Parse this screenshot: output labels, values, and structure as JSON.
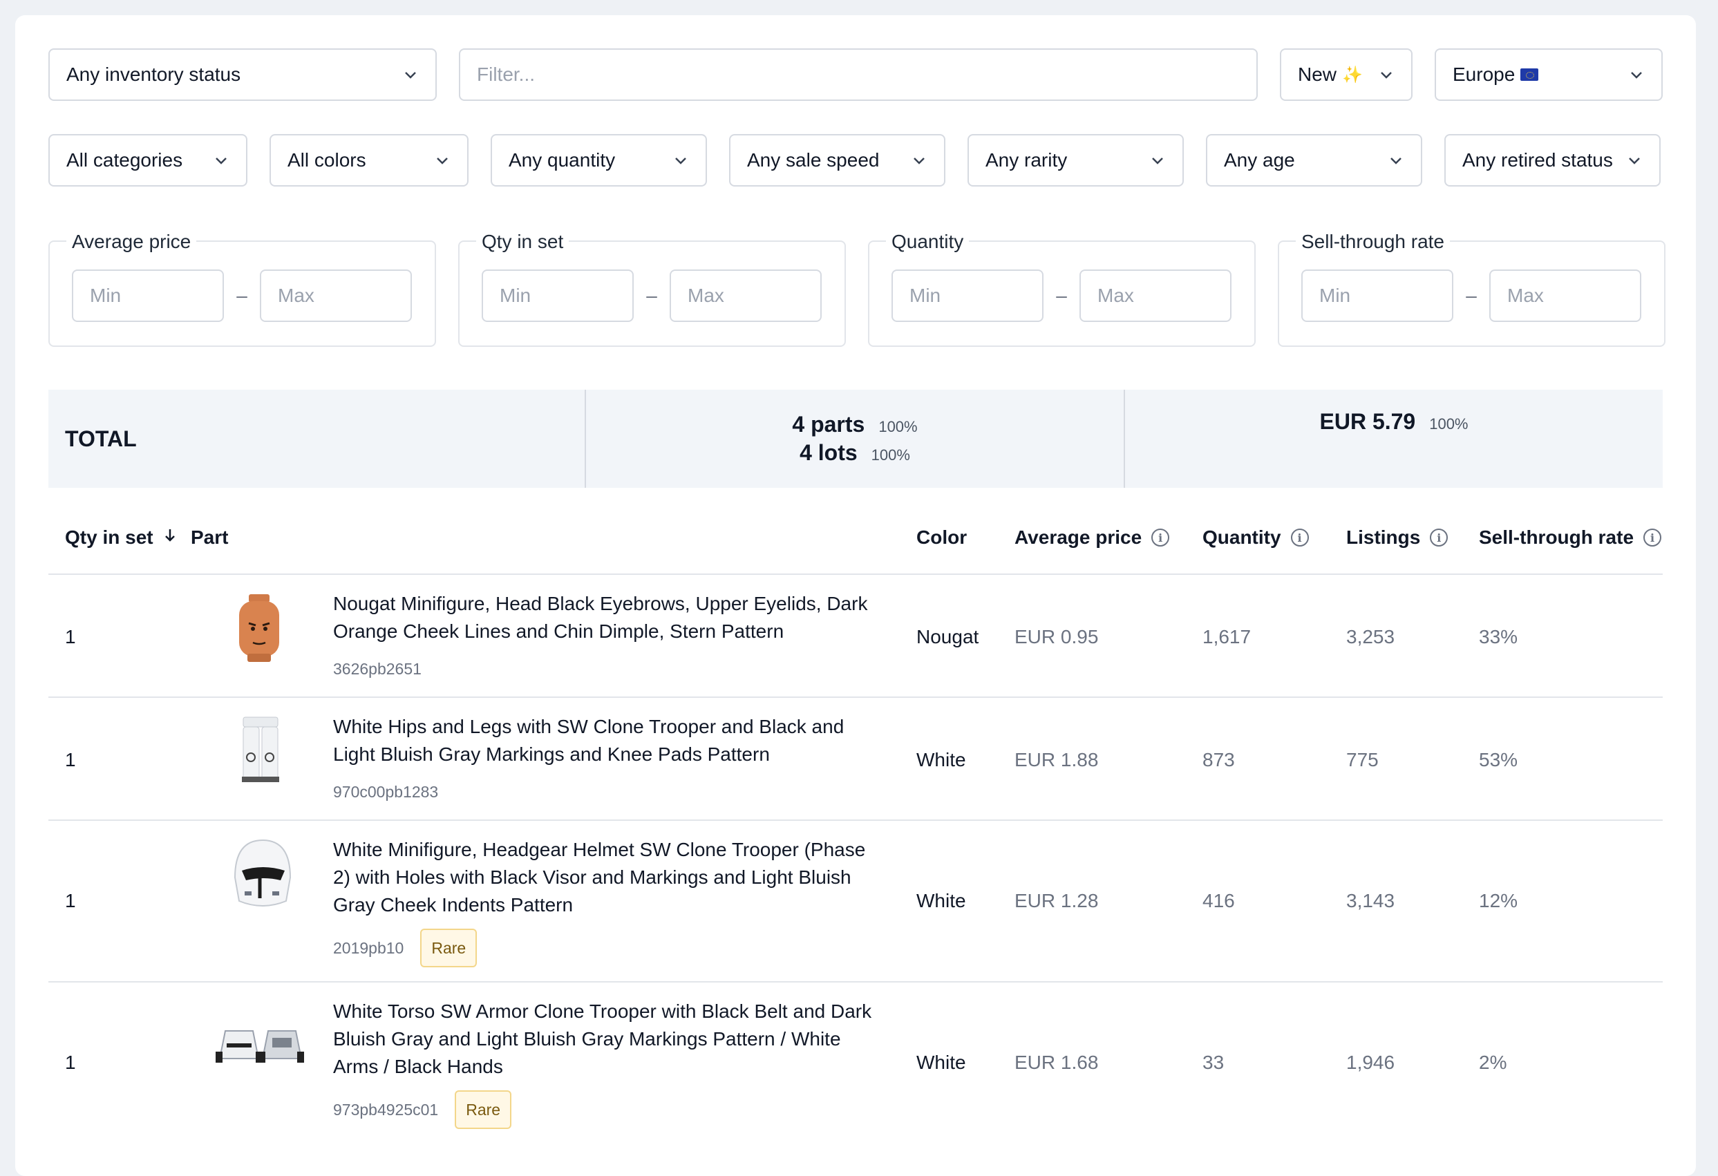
{
  "filters": {
    "inventory_status": "Any inventory status",
    "filter_placeholder": "Filter...",
    "condition": "New",
    "region": "Europe",
    "categories": "All categories",
    "colors": "All colors",
    "quantity": "Any quantity",
    "sale_speed": "Any sale speed",
    "rarity": "Any rarity",
    "age": "Any age",
    "retired_status": "Any retired status"
  },
  "ranges": [
    {
      "label": "Average price",
      "min_placeholder": "Min",
      "max_placeholder": "Max"
    },
    {
      "label": "Qty in set",
      "min_placeholder": "Min",
      "max_placeholder": "Max"
    },
    {
      "label": "Quantity",
      "min_placeholder": "Min",
      "max_placeholder": "Max"
    },
    {
      "label": "Sell-through rate",
      "min_placeholder": "Min",
      "max_placeholder": "Max"
    }
  ],
  "total": {
    "label": "TOTAL",
    "parts": "4 parts",
    "parts_pct": "100%",
    "lots": "4 lots",
    "lots_pct": "100%",
    "value": "EUR 5.79",
    "value_pct": "100%"
  },
  "columns": {
    "qty_in_set": "Qty in set",
    "part": "Part",
    "color": "Color",
    "average_price": "Average price",
    "quantity": "Quantity",
    "listings": "Listings",
    "sell_through": "Sell-through rate"
  },
  "rows": [
    {
      "qty": "1",
      "name": "Nougat Minifigure, Head Black Eyebrows, Upper Eyelids, Dark Orange Cheek Lines and Chin Dimple, Stern Pattern",
      "part_id": "3626pb2651",
      "badge": "",
      "color": "Nougat",
      "avg_price": "EUR 0.95",
      "quantity": "1,617",
      "listings": "3,253",
      "sell_through": "33%"
    },
    {
      "qty": "1",
      "name": "White Hips and Legs with SW Clone Trooper and Black and Light Bluish Gray Markings and Knee Pads Pattern",
      "part_id": "970c00pb1283",
      "badge": "",
      "color": "White",
      "avg_price": "EUR 1.88",
      "quantity": "873",
      "listings": "775",
      "sell_through": "53%"
    },
    {
      "qty": "1",
      "name": "White Minifigure, Headgear Helmet SW Clone Trooper (Phase 2) with Holes with Black Visor and Markings and Light Bluish Gray Cheek Indents Pattern",
      "part_id": "2019pb10",
      "badge": "Rare",
      "color": "White",
      "avg_price": "EUR 1.28",
      "quantity": "416",
      "listings": "3,143",
      "sell_through": "12%"
    },
    {
      "qty": "1",
      "name": "White Torso SW Armor Clone Trooper with Black Belt and Dark Bluish Gray and Light Bluish Gray Markings Pattern / White Arms / Black Hands",
      "part_id": "973pb4925c01",
      "badge": "Rare",
      "color": "White",
      "avg_price": "EUR 1.68",
      "quantity": "33",
      "listings": "1,946",
      "sell_through": "2%"
    }
  ]
}
